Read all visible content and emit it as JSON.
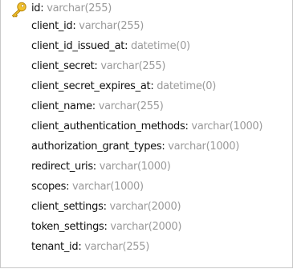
{
  "table": {
    "columns": [
      {
        "name": "id",
        "type": "varchar(255)",
        "primary_key": true
      },
      {
        "name": "client_id",
        "type": "varchar(255)",
        "primary_key": false
      },
      {
        "name": "client_id_issued_at",
        "type": "datetime(0)",
        "primary_key": false
      },
      {
        "name": "client_secret",
        "type": "varchar(255)",
        "primary_key": false
      },
      {
        "name": "client_secret_expires_at",
        "type": "datetime(0)",
        "primary_key": false
      },
      {
        "name": "client_name",
        "type": "varchar(255)",
        "primary_key": false
      },
      {
        "name": "client_authentication_methods",
        "type": "varchar(1000)",
        "primary_key": false
      },
      {
        "name": "authorization_grant_types",
        "type": "varchar(1000)",
        "primary_key": false
      },
      {
        "name": "redirect_uris",
        "type": "varchar(1000)",
        "primary_key": false
      },
      {
        "name": "scopes",
        "type": "varchar(1000)",
        "primary_key": false
      },
      {
        "name": "client_settings",
        "type": "varchar(2000)",
        "primary_key": false
      },
      {
        "name": "token_settings",
        "type": "varchar(2000)",
        "primary_key": false
      },
      {
        "name": "tenant_id",
        "type": "varchar(255)",
        "primary_key": false
      }
    ],
    "separator": ": ",
    "key_icon": "key-icon",
    "colors": {
      "name": "#111111",
      "type": "#9a9a9a",
      "border": "#c9c9c9",
      "key_gold": "#e3b11a"
    }
  }
}
